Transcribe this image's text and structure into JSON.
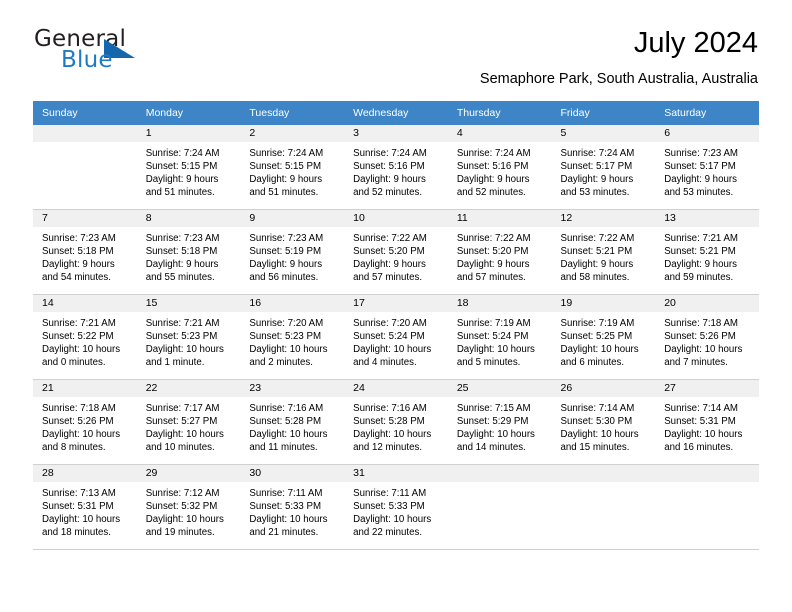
{
  "brand": {
    "name_part1": "General",
    "name_part2": "Blue",
    "logo_icon": "triangle-logo-icon"
  },
  "header": {
    "title": "July 2024",
    "subtitle": "Semaphore Park, South Australia, Australia"
  },
  "colors": {
    "header_row_bg": "#3d85c6",
    "daynum_band_bg": "#f0f0f0",
    "brand_blue": "#1f7ac4",
    "logo_triangle": "#1566ad",
    "grid_line": "#d0d0d0"
  },
  "calendar": {
    "weekday_headers": [
      "Sunday",
      "Monday",
      "Tuesday",
      "Wednesday",
      "Thursday",
      "Friday",
      "Saturday"
    ],
    "weeks": [
      [
        {
          "day": "",
          "lines": []
        },
        {
          "day": "1",
          "lines": [
            "Sunrise: 7:24 AM",
            "Sunset: 5:15 PM",
            "Daylight: 9 hours",
            "and 51 minutes."
          ]
        },
        {
          "day": "2",
          "lines": [
            "Sunrise: 7:24 AM",
            "Sunset: 5:15 PM",
            "Daylight: 9 hours",
            "and 51 minutes."
          ]
        },
        {
          "day": "3",
          "lines": [
            "Sunrise: 7:24 AM",
            "Sunset: 5:16 PM",
            "Daylight: 9 hours",
            "and 52 minutes."
          ]
        },
        {
          "day": "4",
          "lines": [
            "Sunrise: 7:24 AM",
            "Sunset: 5:16 PM",
            "Daylight: 9 hours",
            "and 52 minutes."
          ]
        },
        {
          "day": "5",
          "lines": [
            "Sunrise: 7:24 AM",
            "Sunset: 5:17 PM",
            "Daylight: 9 hours",
            "and 53 minutes."
          ]
        },
        {
          "day": "6",
          "lines": [
            "Sunrise: 7:23 AM",
            "Sunset: 5:17 PM",
            "Daylight: 9 hours",
            "and 53 minutes."
          ]
        }
      ],
      [
        {
          "day": "7",
          "lines": [
            "Sunrise: 7:23 AM",
            "Sunset: 5:18 PM",
            "Daylight: 9 hours",
            "and 54 minutes."
          ]
        },
        {
          "day": "8",
          "lines": [
            "Sunrise: 7:23 AM",
            "Sunset: 5:18 PM",
            "Daylight: 9 hours",
            "and 55 minutes."
          ]
        },
        {
          "day": "9",
          "lines": [
            "Sunrise: 7:23 AM",
            "Sunset: 5:19 PM",
            "Daylight: 9 hours",
            "and 56 minutes."
          ]
        },
        {
          "day": "10",
          "lines": [
            "Sunrise: 7:22 AM",
            "Sunset: 5:20 PM",
            "Daylight: 9 hours",
            "and 57 minutes."
          ]
        },
        {
          "day": "11",
          "lines": [
            "Sunrise: 7:22 AM",
            "Sunset: 5:20 PM",
            "Daylight: 9 hours",
            "and 57 minutes."
          ]
        },
        {
          "day": "12",
          "lines": [
            "Sunrise: 7:22 AM",
            "Sunset: 5:21 PM",
            "Daylight: 9 hours",
            "and 58 minutes."
          ]
        },
        {
          "day": "13",
          "lines": [
            "Sunrise: 7:21 AM",
            "Sunset: 5:21 PM",
            "Daylight: 9 hours",
            "and 59 minutes."
          ]
        }
      ],
      [
        {
          "day": "14",
          "lines": [
            "Sunrise: 7:21 AM",
            "Sunset: 5:22 PM",
            "Daylight: 10 hours",
            "and 0 minutes."
          ]
        },
        {
          "day": "15",
          "lines": [
            "Sunrise: 7:21 AM",
            "Sunset: 5:23 PM",
            "Daylight: 10 hours",
            "and 1 minute."
          ]
        },
        {
          "day": "16",
          "lines": [
            "Sunrise: 7:20 AM",
            "Sunset: 5:23 PM",
            "Daylight: 10 hours",
            "and 2 minutes."
          ]
        },
        {
          "day": "17",
          "lines": [
            "Sunrise: 7:20 AM",
            "Sunset: 5:24 PM",
            "Daylight: 10 hours",
            "and 4 minutes."
          ]
        },
        {
          "day": "18",
          "lines": [
            "Sunrise: 7:19 AM",
            "Sunset: 5:24 PM",
            "Daylight: 10 hours",
            "and 5 minutes."
          ]
        },
        {
          "day": "19",
          "lines": [
            "Sunrise: 7:19 AM",
            "Sunset: 5:25 PM",
            "Daylight: 10 hours",
            "and 6 minutes."
          ]
        },
        {
          "day": "20",
          "lines": [
            "Sunrise: 7:18 AM",
            "Sunset: 5:26 PM",
            "Daylight: 10 hours",
            "and 7 minutes."
          ]
        }
      ],
      [
        {
          "day": "21",
          "lines": [
            "Sunrise: 7:18 AM",
            "Sunset: 5:26 PM",
            "Daylight: 10 hours",
            "and 8 minutes."
          ]
        },
        {
          "day": "22",
          "lines": [
            "Sunrise: 7:17 AM",
            "Sunset: 5:27 PM",
            "Daylight: 10 hours",
            "and 10 minutes."
          ]
        },
        {
          "day": "23",
          "lines": [
            "Sunrise: 7:16 AM",
            "Sunset: 5:28 PM",
            "Daylight: 10 hours",
            "and 11 minutes."
          ]
        },
        {
          "day": "24",
          "lines": [
            "Sunrise: 7:16 AM",
            "Sunset: 5:28 PM",
            "Daylight: 10 hours",
            "and 12 minutes."
          ]
        },
        {
          "day": "25",
          "lines": [
            "Sunrise: 7:15 AM",
            "Sunset: 5:29 PM",
            "Daylight: 10 hours",
            "and 14 minutes."
          ]
        },
        {
          "day": "26",
          "lines": [
            "Sunrise: 7:14 AM",
            "Sunset: 5:30 PM",
            "Daylight: 10 hours",
            "and 15 minutes."
          ]
        },
        {
          "day": "27",
          "lines": [
            "Sunrise: 7:14 AM",
            "Sunset: 5:31 PM",
            "Daylight: 10 hours",
            "and 16 minutes."
          ]
        }
      ],
      [
        {
          "day": "28",
          "lines": [
            "Sunrise: 7:13 AM",
            "Sunset: 5:31 PM",
            "Daylight: 10 hours",
            "and 18 minutes."
          ]
        },
        {
          "day": "29",
          "lines": [
            "Sunrise: 7:12 AM",
            "Sunset: 5:32 PM",
            "Daylight: 10 hours",
            "and 19 minutes."
          ]
        },
        {
          "day": "30",
          "lines": [
            "Sunrise: 7:11 AM",
            "Sunset: 5:33 PM",
            "Daylight: 10 hours",
            "and 21 minutes."
          ]
        },
        {
          "day": "31",
          "lines": [
            "Sunrise: 7:11 AM",
            "Sunset: 5:33 PM",
            "Daylight: 10 hours",
            "and 22 minutes."
          ]
        },
        {
          "day": "",
          "lines": []
        },
        {
          "day": "",
          "lines": []
        },
        {
          "day": "",
          "lines": []
        }
      ]
    ]
  }
}
